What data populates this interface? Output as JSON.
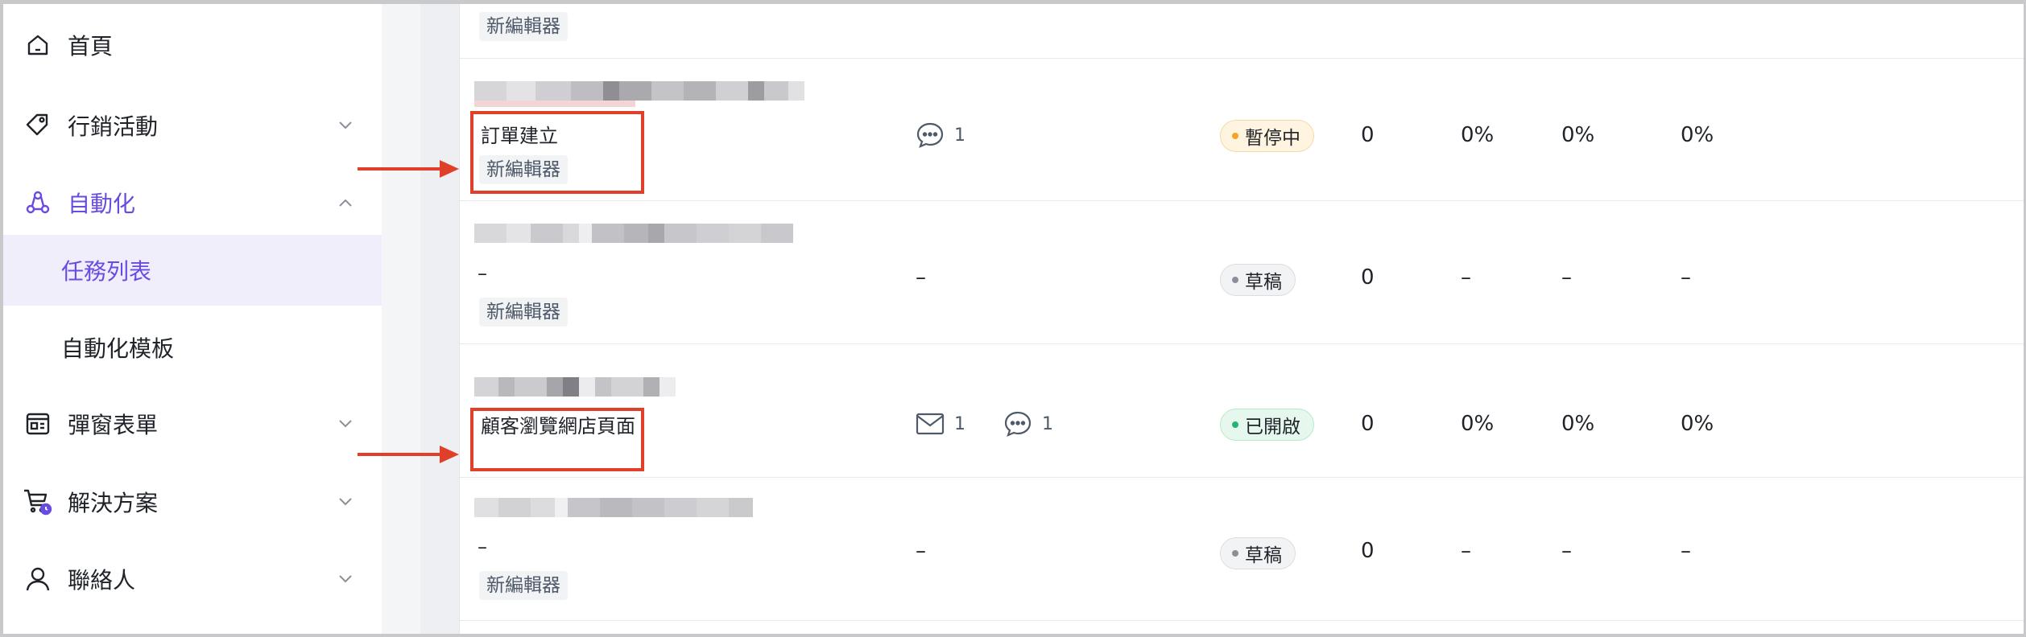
{
  "sidebar": {
    "items": [
      {
        "label": "首頁",
        "icon": "home-icon",
        "expandable": false
      },
      {
        "label": "行銷活動",
        "icon": "tag-icon",
        "expandable": true
      },
      {
        "label": "自動化",
        "icon": "automation-icon",
        "expandable": true,
        "expanded": true,
        "active": true,
        "children": [
          {
            "label": "任務列表",
            "selected": true
          },
          {
            "label": "自動化模板",
            "selected": false
          }
        ]
      },
      {
        "label": "彈窗表單",
        "icon": "popup-form-icon",
        "expandable": true
      },
      {
        "label": "解決方案",
        "icon": "cart-icon",
        "expandable": true
      },
      {
        "label": "聯絡人",
        "icon": "person-icon",
        "expandable": true
      }
    ]
  },
  "table": {
    "rows": [
      {
        "tag": "新編輯器",
        "partial": true
      },
      {
        "trigger": "訂單建立",
        "tag": "新編輯器",
        "channel_line_count": "1",
        "status": "暫停中",
        "count": "0",
        "rate1": "0%",
        "rate2": "0%",
        "rate3": "0%"
      },
      {
        "trigger": "–",
        "tag": "新編輯器",
        "channel": "–",
        "status": "草稿",
        "count": "0",
        "rate1": "–",
        "rate2": "–",
        "rate3": "–"
      },
      {
        "trigger": "顧客瀏覽網店頁面",
        "channel_email_count": "1",
        "channel_line_count": "1",
        "status": "已開啟",
        "count": "0",
        "rate1": "0%",
        "rate2": "0%",
        "rate3": "0%"
      },
      {
        "trigger": "–",
        "tag": "新編輯器",
        "channel": "–",
        "status": "草稿",
        "count": "0",
        "rate1": "–",
        "rate2": "–",
        "rate3": "–"
      }
    ]
  },
  "colors": {
    "accent": "#6a4be0",
    "highlight": "#e0402a",
    "paused": "#f5a524",
    "open": "#22b573",
    "draft": "#8a8f99"
  }
}
